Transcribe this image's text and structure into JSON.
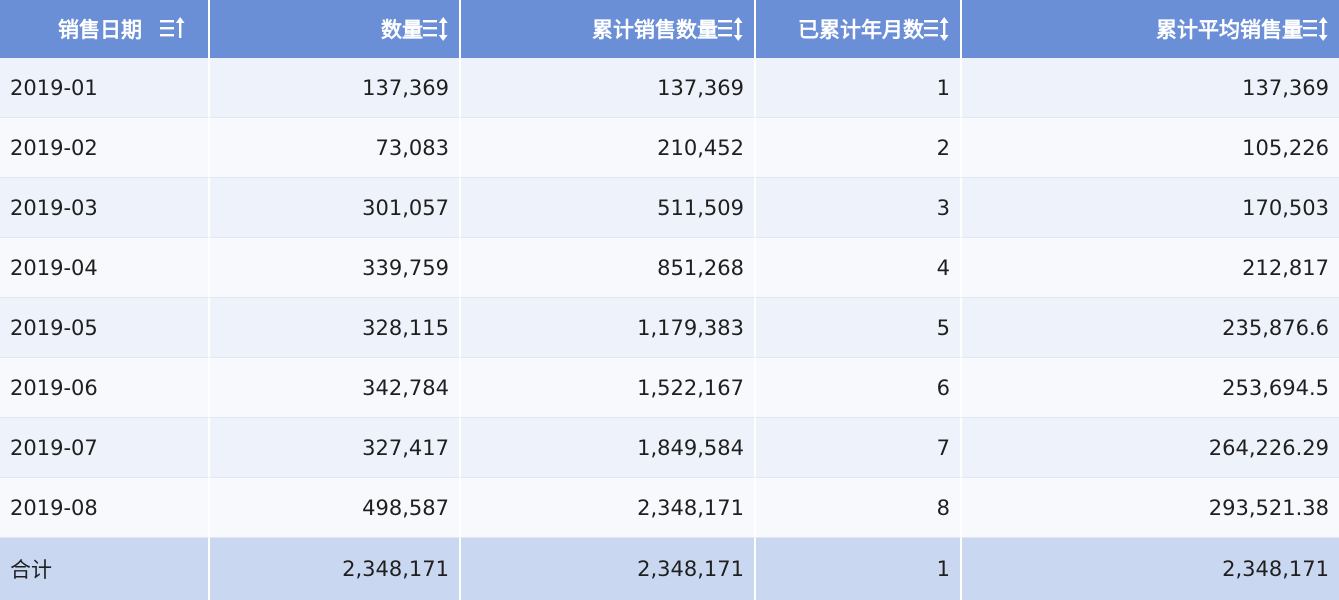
{
  "table": {
    "headers": [
      {
        "label": "销售日期",
        "sort_icon": "sort-asc-icon"
      },
      {
        "label": "数量",
        "sort_icon": "sort-both-icon"
      },
      {
        "label": "累计销售数量",
        "sort_icon": "sort-both-icon"
      },
      {
        "label": "已累计年月数",
        "sort_icon": "sort-both-icon"
      },
      {
        "label": "累计平均销售量",
        "sort_icon": "sort-both-icon"
      }
    ],
    "rows": [
      [
        "2019-01",
        "137,369",
        "137,369",
        "1",
        "137,369"
      ],
      [
        "2019-02",
        "73,083",
        "210,452",
        "2",
        "105,226"
      ],
      [
        "2019-03",
        "301,057",
        "511,509",
        "3",
        "170,503"
      ],
      [
        "2019-04",
        "339,759",
        "851,268",
        "4",
        "212,817"
      ],
      [
        "2019-05",
        "328,115",
        "1,179,383",
        "5",
        "235,876.6"
      ],
      [
        "2019-06",
        "342,784",
        "1,522,167",
        "6",
        "253,694.5"
      ],
      [
        "2019-07",
        "327,417",
        "1,849,584",
        "7",
        "264,226.29"
      ],
      [
        "2019-08",
        "498,587",
        "2,348,171",
        "8",
        "293,521.38"
      ]
    ],
    "total": [
      "合计",
      "2,348,171",
      "2,348,171",
      "1",
      "2,348,171"
    ]
  },
  "colors": {
    "header_bg": "#6b8fd6",
    "row_odd_bg": "#eef3fb",
    "row_even_bg": "#f8f9fd",
    "total_bg": "#c9d8f0"
  }
}
